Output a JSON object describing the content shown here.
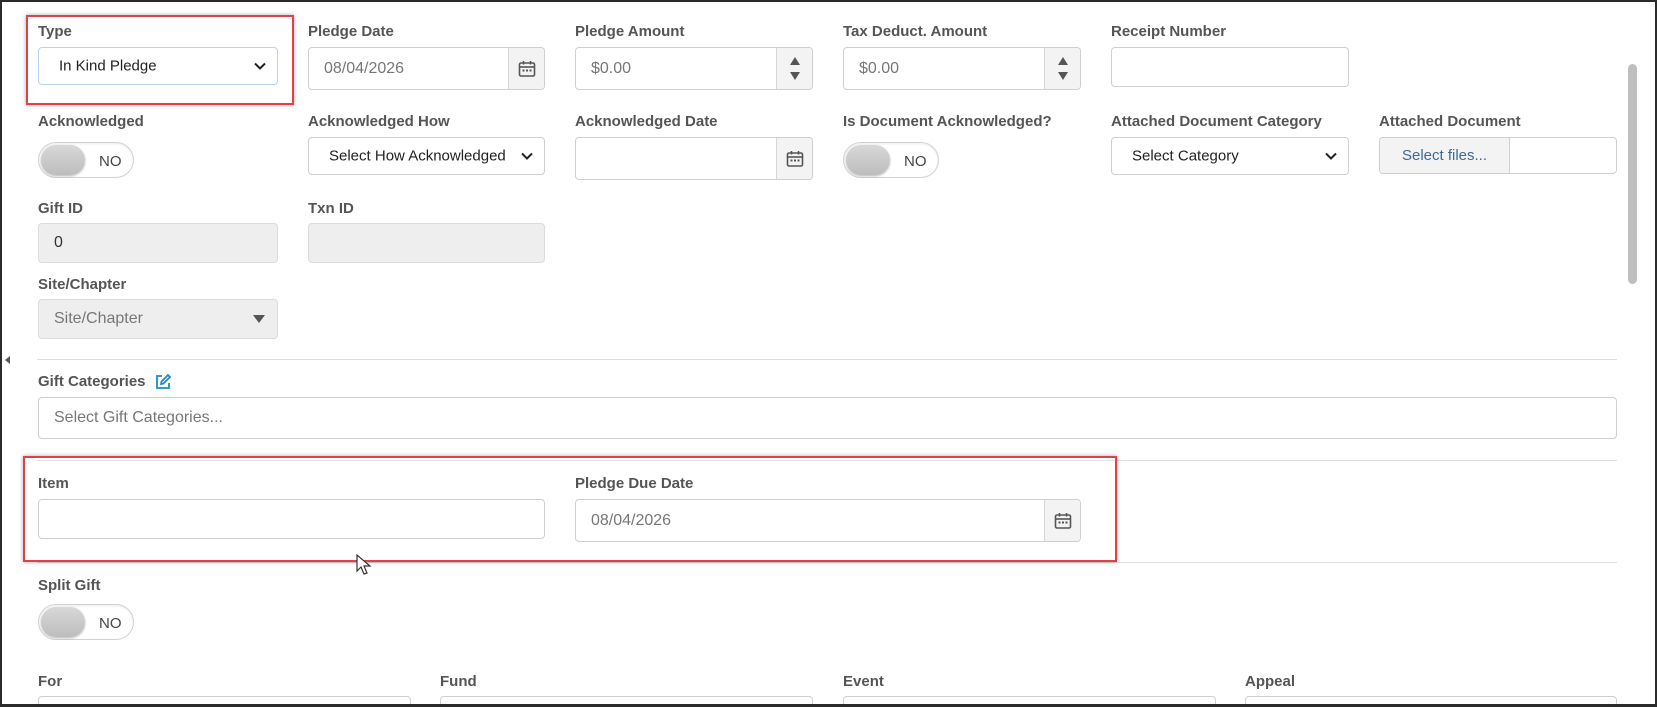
{
  "fields": {
    "type": {
      "label": "Type",
      "value": "In Kind Pledge"
    },
    "pledge_date": {
      "label": "Pledge Date",
      "value": "08/04/2026"
    },
    "pledge_amount": {
      "label": "Pledge Amount",
      "value": "$0.00"
    },
    "tax_deduct_amount": {
      "label": "Tax Deduct. Amount",
      "value": "$0.00"
    },
    "receipt_number": {
      "label": "Receipt Number",
      "value": ""
    },
    "acknowledged": {
      "label": "Acknowledged",
      "value": "NO"
    },
    "acknowledged_how": {
      "label": "Acknowledged How",
      "value": "Select How Acknowledged"
    },
    "acknowledged_date": {
      "label": "Acknowledged Date",
      "value": ""
    },
    "is_document_acknowledged": {
      "label": "Is Document Acknowledged?",
      "value": "NO"
    },
    "attached_document_category": {
      "label": "Attached Document Category",
      "value": "Select Category"
    },
    "attached_document": {
      "label": "Attached Document",
      "button": "Select files..."
    },
    "gift_id": {
      "label": "Gift ID",
      "value": "0"
    },
    "txn_id": {
      "label": "Txn ID",
      "value": ""
    },
    "site_chapter": {
      "label": "Site/Chapter",
      "placeholder": "Site/Chapter"
    },
    "gift_categories": {
      "label": "Gift Categories",
      "placeholder": "Select Gift Categories..."
    },
    "item": {
      "label": "Item",
      "value": ""
    },
    "pledge_due_date": {
      "label": "Pledge Due Date",
      "value": "08/04/2026"
    },
    "split_gift": {
      "label": "Split Gift",
      "value": "NO"
    },
    "for": {
      "label": "For"
    },
    "fund": {
      "label": "Fund"
    },
    "event": {
      "label": "Event"
    },
    "appeal": {
      "label": "Appeal"
    }
  },
  "colors": {
    "highlight": "#e0404a",
    "edit_icon": "#1a8fc9"
  },
  "icons": [
    "calendar-icon",
    "chevron-down-icon",
    "edit-icon",
    "mouse-cursor-icon"
  ]
}
